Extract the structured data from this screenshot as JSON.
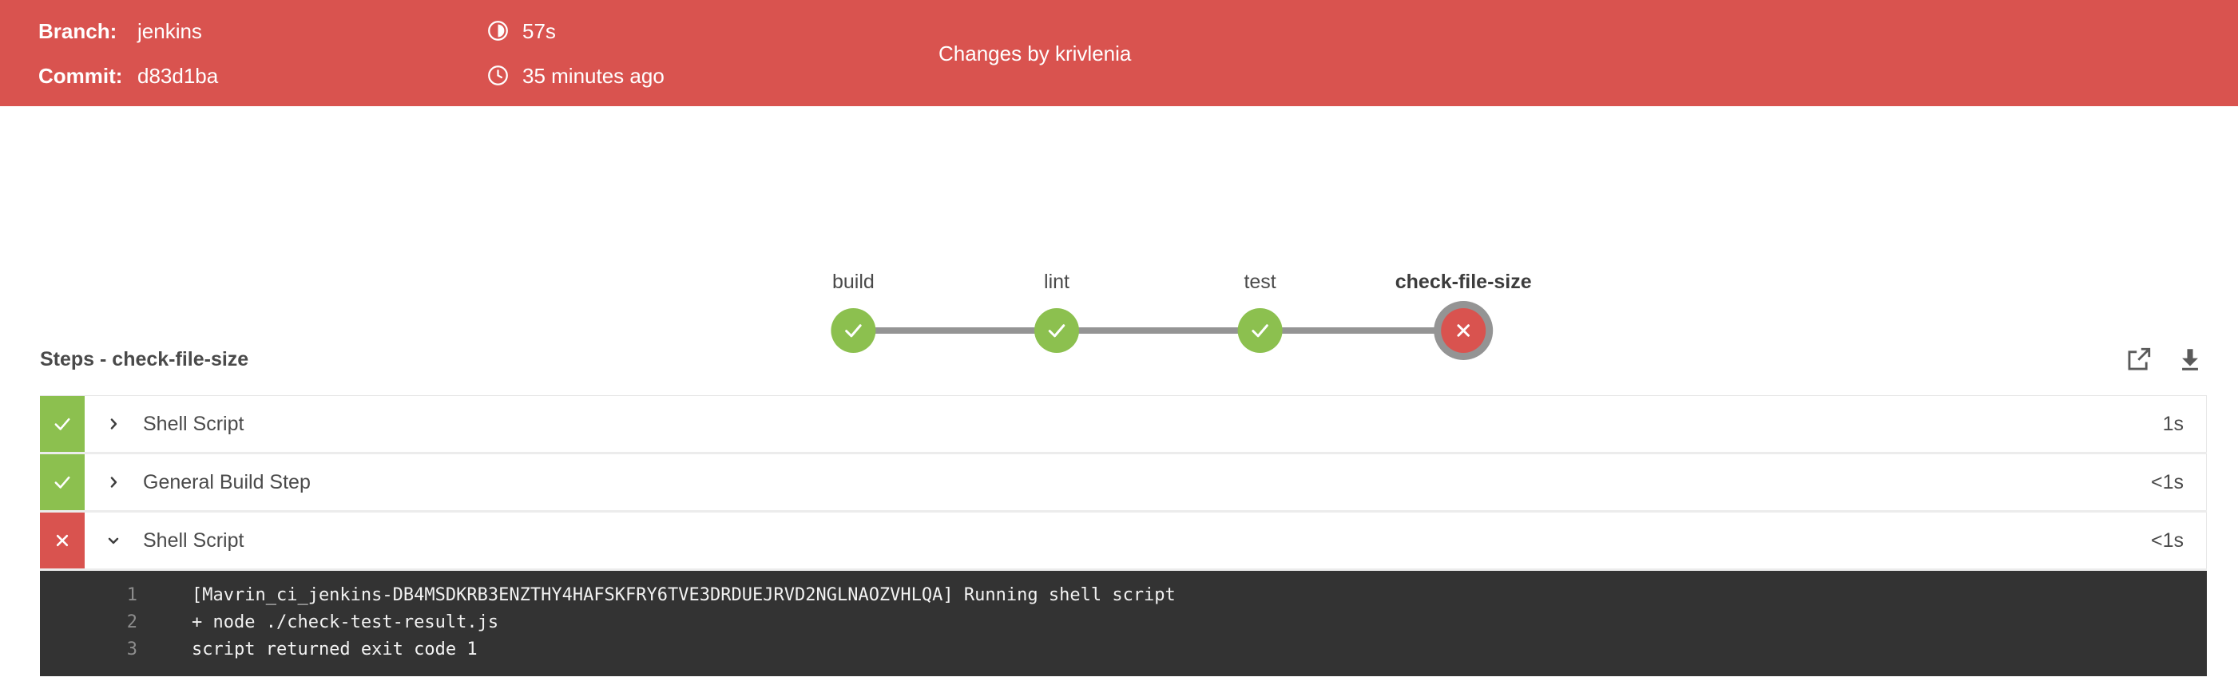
{
  "header": {
    "branch_label": "Branch:",
    "branch_value": "jenkins",
    "commit_label": "Commit:",
    "commit_value": "d83d1ba",
    "duration_icon": "half-circle-timer-icon",
    "duration_value": "57s",
    "time_icon": "clock-icon",
    "time_value": "35 minutes ago",
    "changes_text": "Changes by krivlenia",
    "background_color": "#d9534f",
    "text_color": "#ffffff"
  },
  "pipeline": {
    "stages": [
      {
        "label": "build",
        "status": "success",
        "selected": false
      },
      {
        "label": "lint",
        "status": "success",
        "selected": false
      },
      {
        "label": "test",
        "status": "success",
        "selected": false
      },
      {
        "label": "check-file-size",
        "status": "failure",
        "selected": true
      }
    ],
    "success_color": "#8cc04f",
    "failure_color": "#d9534f",
    "connector_color": "#949494",
    "selection_ring_color": "#949494"
  },
  "steps": {
    "title": "Steps - check-file-size",
    "actions": [
      {
        "name": "open-in-new-window",
        "icon": "external-link-icon"
      },
      {
        "name": "download-logs",
        "icon": "download-icon"
      }
    ],
    "rows": [
      {
        "status": "success",
        "status_icon": "check-icon",
        "caret": "chevron-right-icon",
        "expanded": false,
        "name": "Shell Script",
        "duration": "1s"
      },
      {
        "status": "success",
        "status_icon": "check-icon",
        "caret": "chevron-right-icon",
        "expanded": false,
        "name": "General Build Step",
        "duration": "<1s"
      },
      {
        "status": "failure",
        "status_icon": "cross-icon",
        "caret": "chevron-down-icon",
        "expanded": true,
        "name": "Shell Script",
        "duration": "<1s"
      }
    ]
  },
  "console": {
    "background_color": "#333333",
    "lines": [
      {
        "num": "1",
        "text": "[Mavrin_ci_jenkins-DB4MSDKRB3ENZTHY4HAFSKFRY6TVE3DRDUEJRVD2NGLNAOZVHLQA] Running shell script"
      },
      {
        "num": "2",
        "text": "+ node ./check-test-result.js"
      },
      {
        "num": "3",
        "text": "script returned exit code 1"
      }
    ]
  }
}
